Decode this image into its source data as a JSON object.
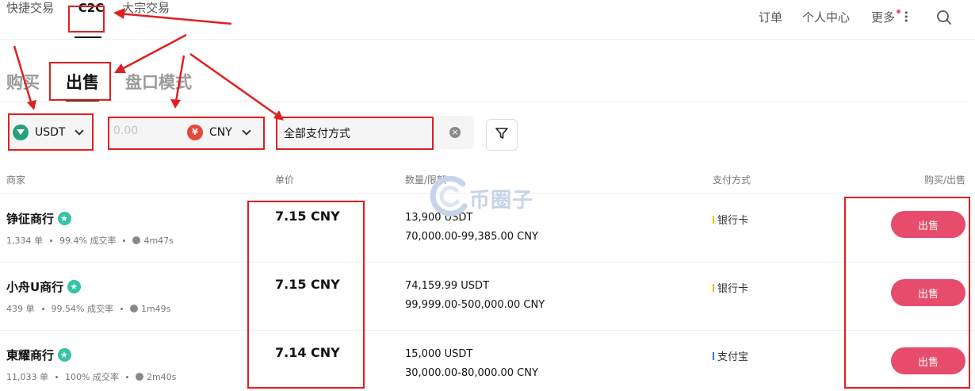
{
  "nav": {
    "quick_trade": "快捷交易",
    "c2c": "C2C",
    "block_trade": "大宗交易",
    "orders": "订单",
    "personal_center": "个人中心",
    "more": "更多"
  },
  "tabs": {
    "buy": "购买",
    "sell": "出售",
    "book_mode": "盘口模式"
  },
  "filters": {
    "coin": "USDT",
    "amount_placeholder": "0.00",
    "currency": "CNY",
    "currency_symbol": "¥",
    "payment": "全部支付方式"
  },
  "table": {
    "headers": {
      "merchant": "商家",
      "price": "单价",
      "qty_limit": "数量/限额",
      "payment": "支付方式",
      "action": "购买/出售"
    },
    "rows": [
      {
        "merchant": "铮征商行",
        "orders": "1,334 单",
        "rate": "99.4% 成交率",
        "time": "4m47s",
        "price": "7.15 CNY",
        "qty": "13,900 USDT",
        "limit": "70,000.00-99,385.00 CNY",
        "payment": "银行卡",
        "payment_color": "#f0b90b",
        "action": "出售"
      },
      {
        "merchant": "小舟U商行",
        "orders": "439 单",
        "rate": "99.54% 成交率",
        "time": "1m49s",
        "price": "7.15 CNY",
        "qty": "74,159.99 USDT",
        "limit": "99,999.00-500,000.00 CNY",
        "payment": "银行卡",
        "payment_color": "#f0b90b",
        "action": "出售"
      },
      {
        "merchant": "東耀商行",
        "orders": "11,033 单",
        "rate": "100% 成交率",
        "time": "2m40s",
        "price": "7.14 CNY",
        "qty": "15,000 USDT",
        "limit": "30,000.00-80,000.00 CNY",
        "payment": "支付宝",
        "payment_color": "#1677ff",
        "action": "出售"
      }
    ]
  },
  "watermark": "币圈子",
  "colors": {
    "accent_sell": "#e84c6b",
    "annotation_red": "#e02020",
    "verified": "#36c3a6"
  },
  "icons": {
    "search": "search-icon",
    "filter": "filter-icon",
    "coin": "usdt-icon",
    "currency": "yen-icon",
    "clear": "clear-icon",
    "more": "kebab-icon"
  }
}
